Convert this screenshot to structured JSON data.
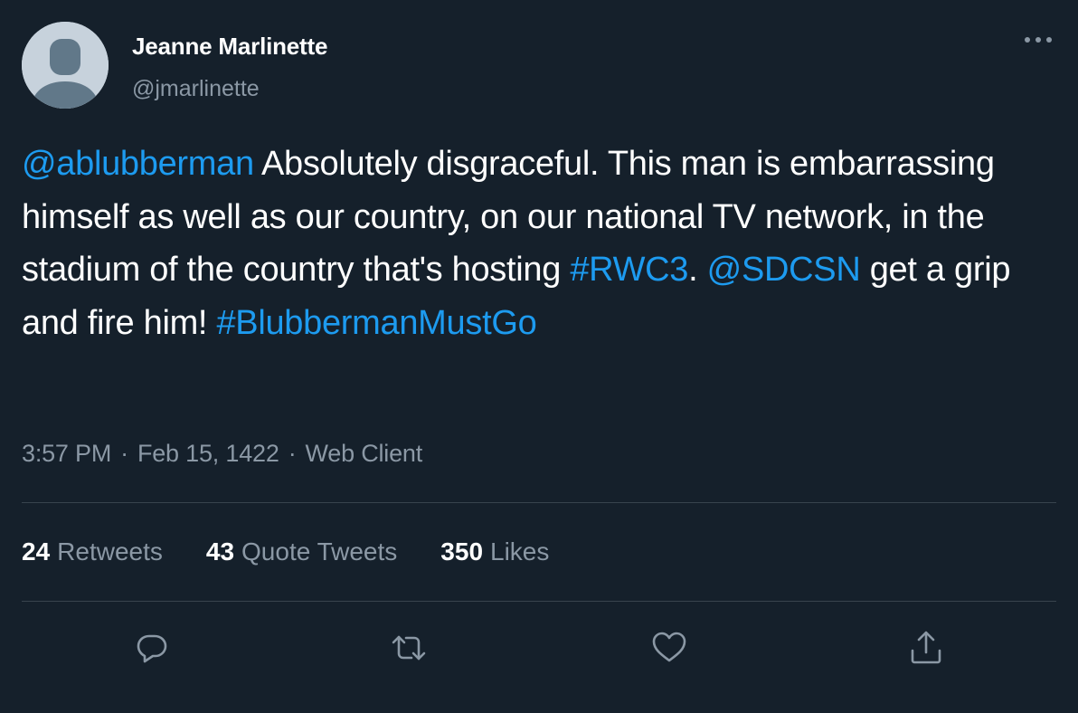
{
  "author": {
    "display_name": "Jeanne Marlinette",
    "handle": "@jmarlinette"
  },
  "tweet": {
    "segments": [
      {
        "text": "@ablubberman",
        "type": "mention"
      },
      {
        "text": " Absolutely disgraceful. This man is embarrassing himself as well as our country, on our national TV network, in the stadium of the country that's hosting ",
        "type": "text"
      },
      {
        "text": "#RWC3",
        "type": "hashtag"
      },
      {
        "text": ". ",
        "type": "text"
      },
      {
        "text": "@SDCSN",
        "type": "mention"
      },
      {
        "text": " get a grip and fire him! ",
        "type": "text"
      },
      {
        "text": "#BlubbermanMustGo",
        "type": "hashtag"
      }
    ],
    "time": "3:57 PM",
    "separator": "·",
    "date": "Feb 15, 1422",
    "source": "Web Client"
  },
  "stats": {
    "retweets_count": "24",
    "retweets_label": "Retweets",
    "quotes_count": "43",
    "quotes_label": "Quote Tweets",
    "likes_count": "350",
    "likes_label": "Likes"
  },
  "actions": {
    "reply_icon": "reply-icon",
    "retweet_icon": "retweet-icon",
    "like_icon": "heart-icon",
    "share_icon": "share-icon",
    "more_icon": "more-horizontal-icon"
  },
  "colors": {
    "background": "#15202b",
    "link": "#1d9bf0",
    "secondary_text": "#8b98a5",
    "divider": "#38444d"
  }
}
